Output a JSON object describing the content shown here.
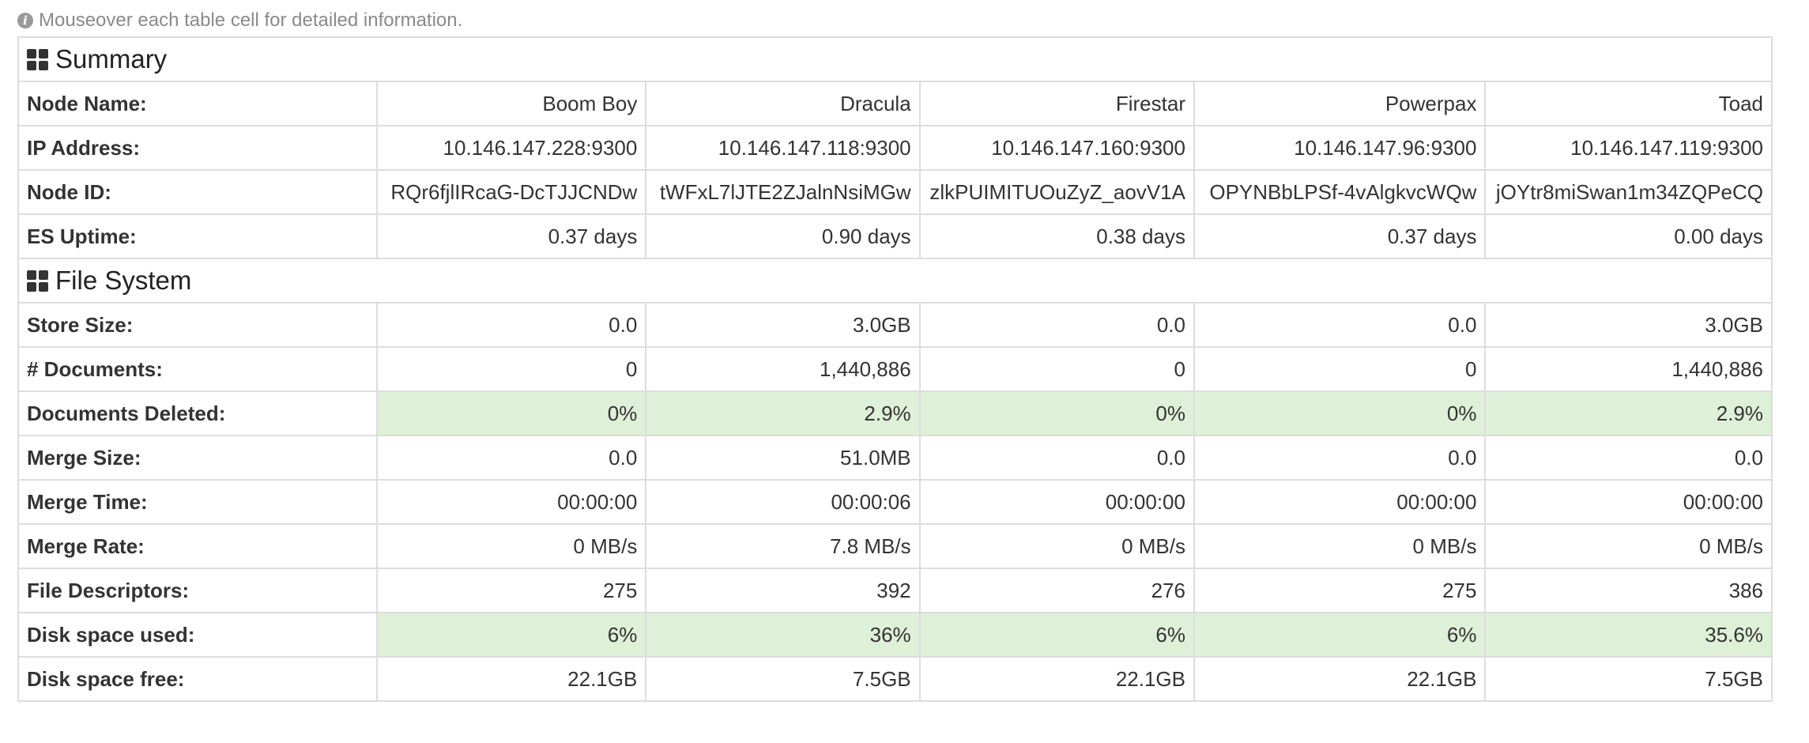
{
  "hint": {
    "icon": "info-icon",
    "text": "Mouseover each table cell for detailed information."
  },
  "colors": {
    "border": "#dddddd",
    "highlight_green": "#dff0d8",
    "hint_text": "#8a8a8a",
    "text": "#333333"
  },
  "sections": [
    {
      "title": "Summary",
      "icon": "th-large-icon",
      "rows": [
        {
          "label": "Node Name:",
          "values": [
            "Boom Boy",
            "Dracula",
            "Firestar",
            "Powerpax",
            "Toad"
          ],
          "highlight": false
        },
        {
          "label": "IP Address:",
          "values": [
            "10.146.147.228:9300",
            "10.146.147.118:9300",
            "10.146.147.160:9300",
            "10.146.147.96:9300",
            "10.146.147.119:9300"
          ],
          "highlight": false
        },
        {
          "label": "Node ID:",
          "values": [
            "RQr6fjlIRcaG-DcTJJCNDw",
            "tWFxL7lJTE2ZJalnNsiMGw",
            "zlkPUIMITUOuZyZ_aovV1A",
            "OPYNBbLPSf-4vAlgkvcWQw",
            "jOYtr8miSwan1m34ZQPeCQ"
          ],
          "highlight": false
        },
        {
          "label": "ES Uptime:",
          "values": [
            "0.37 days",
            "0.90 days",
            "0.38 days",
            "0.37 days",
            "0.00 days"
          ],
          "highlight": false
        }
      ]
    },
    {
      "title": "File System",
      "icon": "th-large-icon",
      "rows": [
        {
          "label": "Store Size:",
          "values": [
            "0.0",
            "3.0GB",
            "0.0",
            "0.0",
            "3.0GB"
          ],
          "highlight": false
        },
        {
          "label": "# Documents:",
          "values": [
            "0",
            "1,440,886",
            "0",
            "0",
            "1,440,886"
          ],
          "highlight": false
        },
        {
          "label": "Documents Deleted:",
          "values": [
            "0%",
            "2.9%",
            "0%",
            "0%",
            "2.9%"
          ],
          "highlight": true
        },
        {
          "label": "Merge Size:",
          "values": [
            "0.0",
            "51.0MB",
            "0.0",
            "0.0",
            "0.0"
          ],
          "highlight": false
        },
        {
          "label": "Merge Time:",
          "values": [
            "00:00:00",
            "00:00:06",
            "00:00:00",
            "00:00:00",
            "00:00:00"
          ],
          "highlight": false
        },
        {
          "label": "Merge Rate:",
          "values": [
            "0 MB/s",
            "7.8 MB/s",
            "0 MB/s",
            "0 MB/s",
            "0 MB/s"
          ],
          "highlight": false
        },
        {
          "label": "File Descriptors:",
          "values": [
            "275",
            "392",
            "276",
            "275",
            "386"
          ],
          "highlight": false
        },
        {
          "label": "Disk space used:",
          "values": [
            "6%",
            "36%",
            "6%",
            "6%",
            "35.6%"
          ],
          "highlight": true
        },
        {
          "label": "Disk space free:",
          "values": [
            "22.1GB",
            "7.5GB",
            "22.1GB",
            "22.1GB",
            "7.5GB"
          ],
          "highlight": false
        }
      ]
    }
  ]
}
